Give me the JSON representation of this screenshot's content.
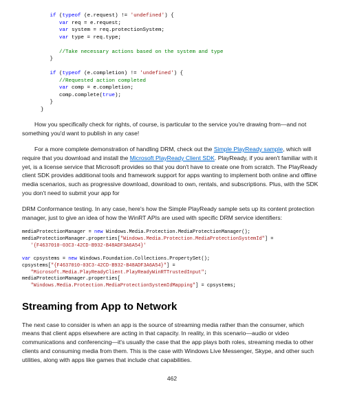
{
  "code1": {
    "l1a": "if",
    "l1b": " (",
    "l1c": "typeof",
    "l1d": " (e.request) != ",
    "l1e": "'undefined'",
    "l1f": ") {",
    "l2a": "var",
    "l2b": " req = e.request;",
    "l3a": "var",
    "l3b": " system = req.protectionSystem;",
    "l4a": "var",
    "l4b": " type = req.type;",
    "l5": "//Take necessary actions based on the system and type",
    "l6": "}",
    "l7a": "if",
    "l7b": " (",
    "l7c": "typeof",
    "l7d": " (e.completion) != ",
    "l7e": "'undefined'",
    "l7f": ") {",
    "l8": "//Requested action completed",
    "l9a": "var",
    "l9b": " comp = e.completion;",
    "l10a": "comp.complete(",
    "l10b": "true",
    "l10c": ");",
    "l11": "}",
    "l12": "}"
  },
  "p1": "How you specifically check for rights, of course, is particular to the service you're drawing from—and not something you'd want to publish in any case!",
  "p2a": "For a more complete demonstration of handling DRM, check out the ",
  "link1": "Simple PlayReady sample",
  "p2b": ", which will require that you download and install the ",
  "link2": "Microsoft PlayReady Client SDK",
  "p2c": ". PlayReady, if you aren't familiar with it yet, is a license service that Microsoft provides so that you don't have to create one from scratch. The PlayReady client SDK    provides additional tools and framework support for apps wanting to implement both online and offline media scenarios, such as progressive download, download to own, rentals, and subscriptions. Plus, with the SDK you don't need to submit your app for",
  "p3": "DRM Conformance testing. In any case, here's how the Simple PlayReady sample sets up its content protection manager, just to give an idea of how the WinRT APIs are used with specific DRM service identifiers:",
  "code2": {
    "l1a": "mediaProtectionManager = ",
    "l1b": "new",
    "l1c": " Windows.Media.Protection.MediaProtectionManager();",
    "l2a": "mediaProtectionManager.properties[",
    "l2b": "\"Windows.Media.Protection.MediaProtectionSystemId\"",
    "l2c": "] =",
    "l3": "'{F4637010-03C3-42CD-B932-B48ADF3A6A54}'",
    "l4a": "var",
    "l4b": " cpsystems = ",
    "l4c": "new",
    "l4d": " Windows.Foundation.Collections.PropertySet();",
    "l5a": "cpsystems[",
    "l5b": "\"{F4637010-03C3-42CD-B932-B48ADF3A6A54}\"",
    "l5c": "] =",
    "l6": "\"Microsoft.Media.PlayReadyClient.PlayReadyWinRTTrustedInput\"",
    "l6b": ";",
    "l7": "mediaProtectionManager.properties[",
    "l8": "\"Windows.Media.Protection.MediaProtectionSystemIdMapping\"",
    "l8b": "] = cpsystems;"
  },
  "heading": "Streaming from App to Network",
  "p4": "The next case to consider is when an app is the source of streaming media rather than the consumer, which means that client apps elsewhere are acting in that capacity. In reality, in this scenario—audio or video communications and conferencing—it's usually the case that the app plays both roles, streaming media to other clients and consuming media from them. This is the case with Windows Live Messenger, Skype, and other such utilities, along with apps like games that include chat capabilities.",
  "pagenum": "462"
}
